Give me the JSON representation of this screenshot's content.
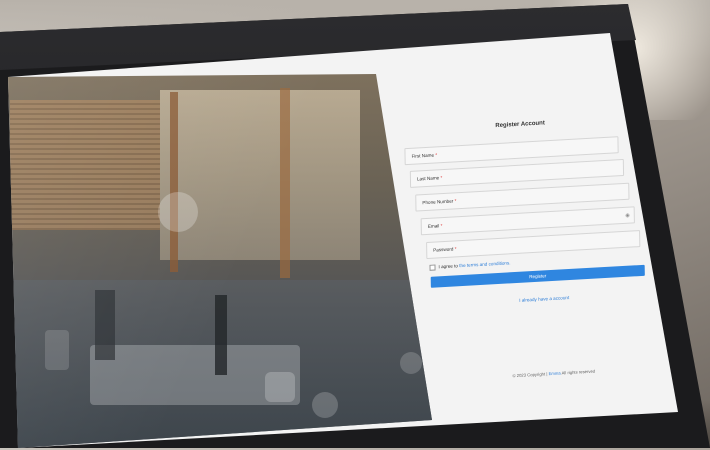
{
  "form": {
    "title": "Register Account",
    "fields": [
      {
        "label": "First Name",
        "required": "*"
      },
      {
        "label": "Last Name",
        "required": "*"
      },
      {
        "label": "Phone Number",
        "required": "*"
      },
      {
        "label": "Email",
        "required": "*"
      },
      {
        "label": "Password",
        "required": "*"
      }
    ],
    "agree_prefix": "I agree to",
    "agree_link": "the terms and conditions.",
    "register_label": "Register",
    "login_link": "I already have a account",
    "copyright_prefix": "© 2023 Copyright |",
    "copyright_brand": "Emma",
    "copyright_suffix": "All rights reserved"
  },
  "icons": {
    "password_toggle": "eye-icon"
  },
  "colors": {
    "accent": "#2f86e0",
    "link": "#2f7fd8",
    "screen_bg": "#f3f3f3"
  }
}
